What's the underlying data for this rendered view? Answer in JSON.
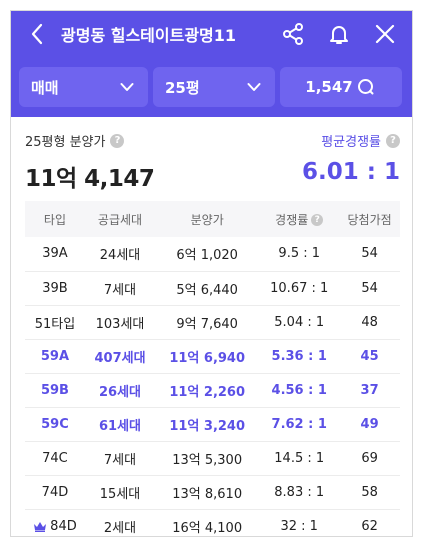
{
  "header": {
    "title": "광명동 힐스테이트광명11",
    "filters": {
      "trade_type": "매매",
      "area": "25평",
      "views": "1,547"
    }
  },
  "summary": {
    "price_label": "25평형 분양가",
    "price": "11억 4,147",
    "ratio_label": "평균경쟁률",
    "ratio": "6.01 : 1"
  },
  "table": {
    "headers": [
      "타입",
      "공급세대",
      "분양가",
      "경쟁률",
      "당첨가점"
    ],
    "rows": [
      {
        "type": "39A",
        "supply": "24세대",
        "price": "6억 1,020",
        "ratio": "9.5 : 1",
        "score": "54"
      },
      {
        "type": "39B",
        "supply": "7세대",
        "price": "5억 6,440",
        "ratio": "10.67 : 1",
        "score": "54"
      },
      {
        "type": "51타입",
        "supply": "103세대",
        "price": "9억 7,640",
        "ratio": "5.04 : 1",
        "score": "48"
      },
      {
        "type": "59A",
        "supply": "407세대",
        "price": "11억 6,940",
        "ratio": "5.36 : 1",
        "score": "45"
      },
      {
        "type": "59B",
        "supply": "26세대",
        "price": "11억 2,260",
        "ratio": "4.56 : 1",
        "score": "37"
      },
      {
        "type": "59C",
        "supply": "61세대",
        "price": "11억 3,240",
        "ratio": "7.62 : 1",
        "score": "49"
      },
      {
        "type": "74C",
        "supply": "7세대",
        "price": "13억 5,300",
        "ratio": "14.5 : 1",
        "score": "69"
      },
      {
        "type": "74D",
        "supply": "15세대",
        "price": "13억 8,610",
        "ratio": "8.83 : 1",
        "score": "58"
      },
      {
        "type": "84D",
        "supply": "2세대",
        "price": "16억 4,100",
        "ratio": "32 : 1",
        "score": "62"
      }
    ]
  },
  "colors": {
    "accent": "#5b50e6",
    "control_bg": "#6f64ef",
    "crown": "#5b50e6"
  },
  "icons": {
    "back": "chevron-left-icon",
    "share": "share-icon",
    "bell": "bell-icon",
    "close": "close-icon",
    "search": "search-icon",
    "crown": "crown-icon"
  }
}
